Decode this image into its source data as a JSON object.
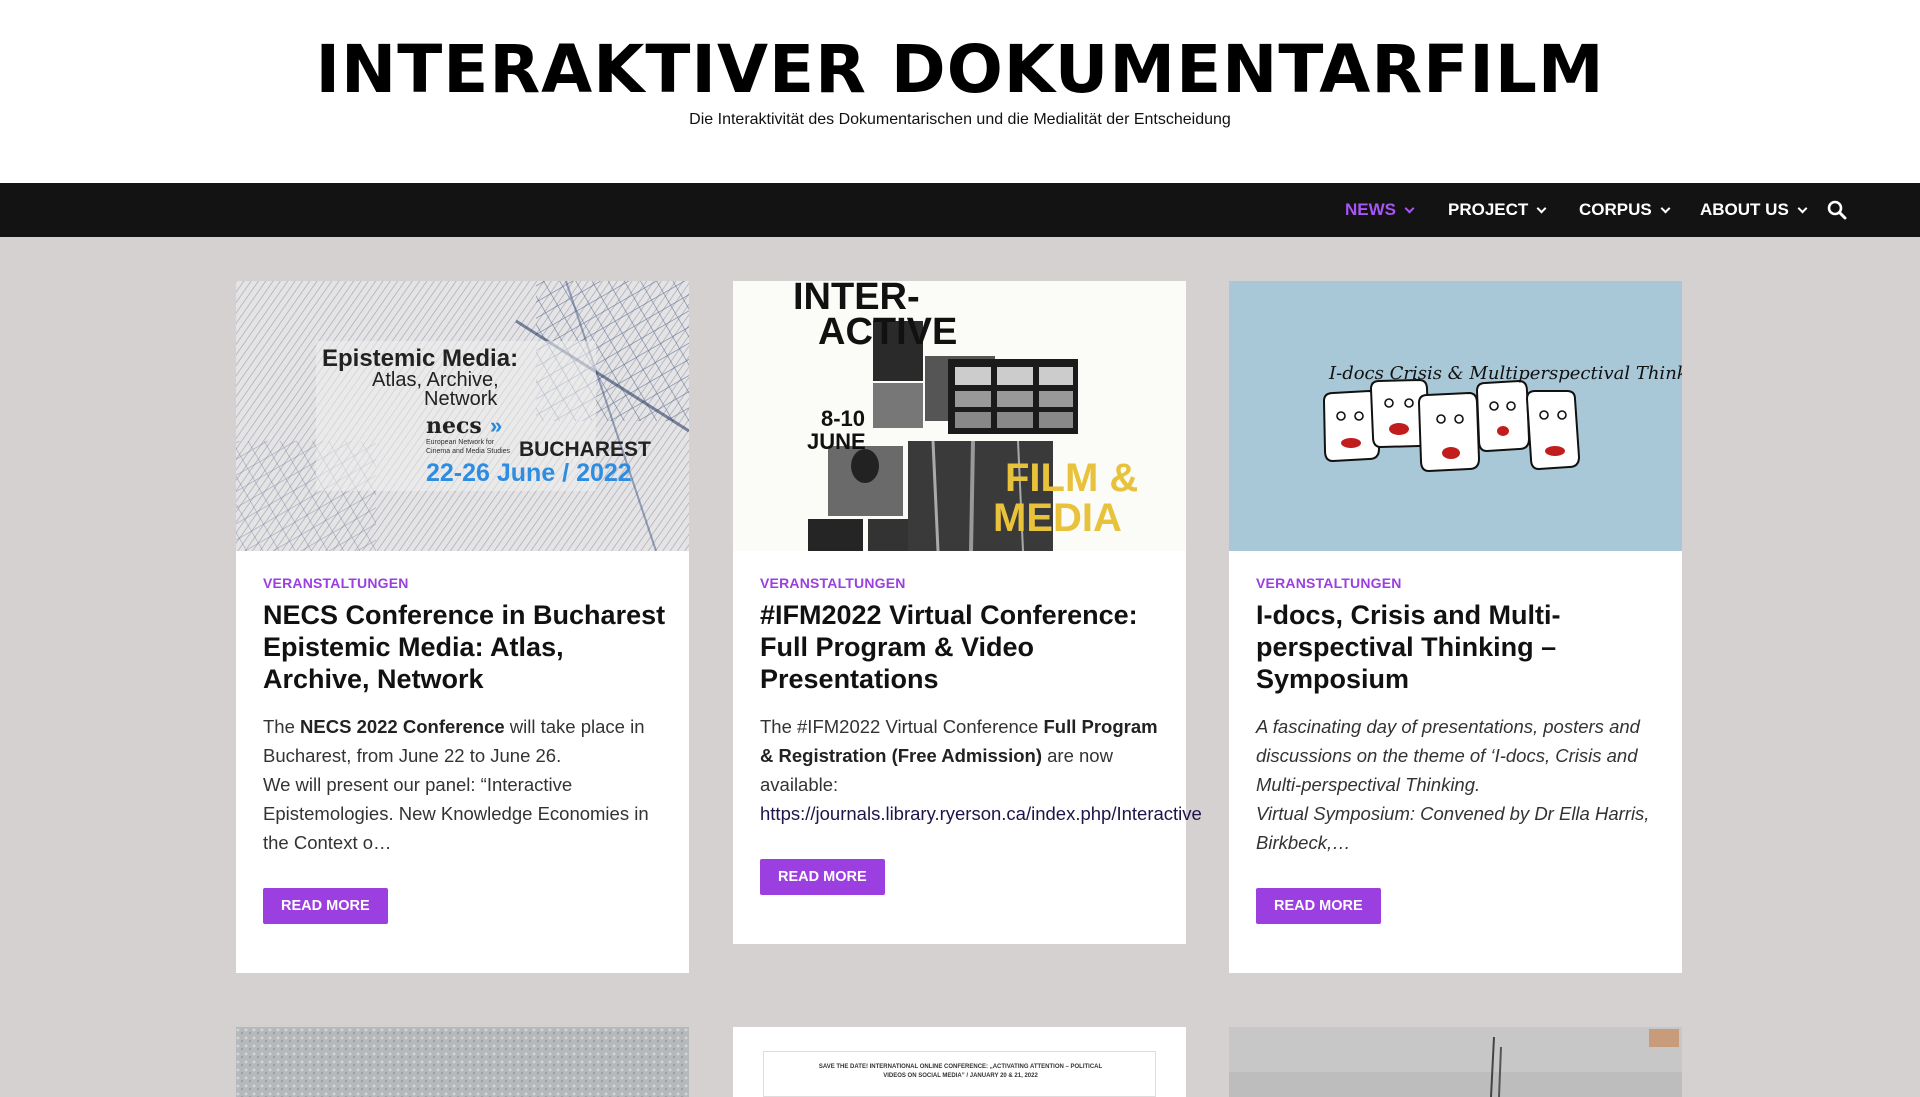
{
  "site": {
    "title": "INTERAKTIVER DOKUMENTARFILM",
    "description": "Die Interaktivität des Dokumentarischen und die Medialität der Entscheidung"
  },
  "nav": {
    "items": [
      {
        "label": "NEWS",
        "active": true
      },
      {
        "label": "PROJECT"
      },
      {
        "label": "CORPUS"
      },
      {
        "label": "ABOUT US"
      }
    ],
    "search_icon": "search-icon"
  },
  "colors": {
    "accent": "#9b3fe0",
    "nav_bg": "#131313",
    "page_bg": "#d6d1d1"
  },
  "posts": [
    {
      "thumb": {
        "title": "Epistemic Media:",
        "subtitle": "Atlas, Archive,",
        "subtitle2": "Network",
        "logo": "necs",
        "org_line1": "European Network for",
        "org_line2": "Cinema and Media Studies",
        "city": "BUCHAREST",
        "dates": "22-26 June / 2022"
      },
      "category": "VERANSTALTUNGEN",
      "title": "NECS Conference in Bucharest Epistemic Media: Atlas, Archive, Network",
      "excerpt": {
        "p1": "The ",
        "p1_bold": "NECS 2022 Conference",
        "p1_rest": " will take place in Bucharest, from June 22 to June 26.",
        "p2": "We will present our panel: “Interactive Epistemologies. New Knowledge Economies in the Context o…"
      },
      "button": "READ MORE"
    },
    {
      "thumb": {
        "line1": "INTER-",
        "line2": "ACTIVE",
        "dates": "8-10",
        "month": "JUNE",
        "film": "FILM &",
        "media": "MEDIA"
      },
      "category": "VERANSTALTUNGEN",
      "title": "#IFM2022 Virtual Conference: Full Program & Video Presentations",
      "excerpt": {
        "p1": "The #IFM2022 Virtual Conference ",
        "p1_bold": "Full Program & Registration (Free Admission)",
        "p1_rest": " are now available:",
        "link": "https://journals.library.ryerson.ca/index.php/Interactive"
      },
      "button": "READ MORE"
    },
    {
      "thumb": {
        "script": "I-docs Crisis & Multiperspectival Thinking"
      },
      "category": "VERANSTALTUNGEN",
      "title": "I-docs, Crisis and Multi-perspectival Thinking – Symposium",
      "excerpt": {
        "p1": "A fascinating day of presentations, posters and discussions on the theme of ‘I-docs, Crisis and Multi-perspectival Thinking.",
        "p2": "Virtual Symposium: Convened by Dr Ella Harris, Birkbeck,…"
      },
      "button": "READ MORE"
    }
  ],
  "bottom_row": {
    "card2_text1": "SAVE THE DATE! INTERNATIONAL ONLINE CONFERENCE: „ACTIVATING ATTENTION – POLITICAL",
    "card2_text2": "VIDEOS ON SOCIAL MEDIA” / JANUARY 20 & 21, 2022"
  }
}
